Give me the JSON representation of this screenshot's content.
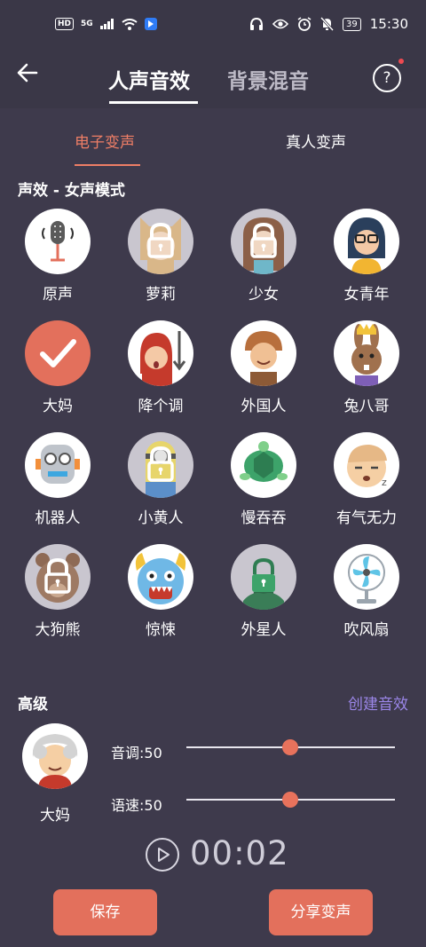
{
  "status_bar": {
    "left_chips": [
      "HD",
      "5G"
    ],
    "battery": "39",
    "time": "15:30"
  },
  "header": {
    "tabs": [
      {
        "label": "人声音效",
        "active": true
      },
      {
        "label": "背景混音",
        "active": false
      }
    ],
    "help_label": "?"
  },
  "sub_tabs": [
    {
      "label": "电子变声",
      "active": true
    },
    {
      "label": "真人变声",
      "active": false
    }
  ],
  "section_title": "声效 - 女声模式",
  "effects": [
    {
      "label": "原声",
      "icon": "microphone-icon",
      "locked": false,
      "bg": "#ffffff"
    },
    {
      "label": "萝莉",
      "icon": "loli-girl-icon",
      "locked": true,
      "bg": "#c9c6cf"
    },
    {
      "label": "少女",
      "icon": "teen-girl-icon",
      "locked": true,
      "bg": "#c9c6cf"
    },
    {
      "label": "女青年",
      "icon": "young-woman-icon",
      "locked": false,
      "bg": "#ffffff"
    },
    {
      "label": "大妈",
      "icon": "checkmark-icon",
      "locked": false,
      "selected": true,
      "bg": "#e3705c"
    },
    {
      "label": "降个调",
      "icon": "pitch-down-icon",
      "locked": false,
      "bg": "#ffffff"
    },
    {
      "label": "外国人",
      "icon": "foreigner-icon",
      "locked": false,
      "bg": "#ffffff"
    },
    {
      "label": "兔八哥",
      "icon": "bunny-icon",
      "locked": false,
      "bg": "#ffffff"
    },
    {
      "label": "机器人",
      "icon": "robot-icon",
      "locked": false,
      "bg": "#ffffff"
    },
    {
      "label": "小黄人",
      "icon": "minion-icon",
      "locked": true,
      "bg": "#c9c6cf"
    },
    {
      "label": "慢吞吞",
      "icon": "turtle-icon",
      "locked": false,
      "bg": "#ffffff"
    },
    {
      "label": "有气无力",
      "icon": "sleepy-face-icon",
      "locked": false,
      "bg": "#ffffff"
    },
    {
      "label": "大狗熊",
      "icon": "bear-icon",
      "locked": true,
      "bg": "#c9c6cf"
    },
    {
      "label": "惊悚",
      "icon": "monster-icon",
      "locked": false,
      "bg": "#ffffff"
    },
    {
      "label": "外星人",
      "icon": "alien-icon",
      "locked": true,
      "bg": "#c9c6cf"
    },
    {
      "label": "吹风扇",
      "icon": "fan-icon",
      "locked": false,
      "bg": "#ffffff"
    }
  ],
  "advanced": {
    "title": "高级",
    "create_label": "创建音效",
    "avatar_label": "大妈",
    "pitch_label": "音调:50",
    "pitch_value": 50,
    "speed_label": "语速:50",
    "speed_value": 50
  },
  "player": {
    "time": "00:02"
  },
  "buttons": {
    "save": "保存",
    "share": "分享变声"
  },
  "colors": {
    "accent": "#e3705c",
    "link": "#9b86e8",
    "background": "#3e3a4c"
  }
}
